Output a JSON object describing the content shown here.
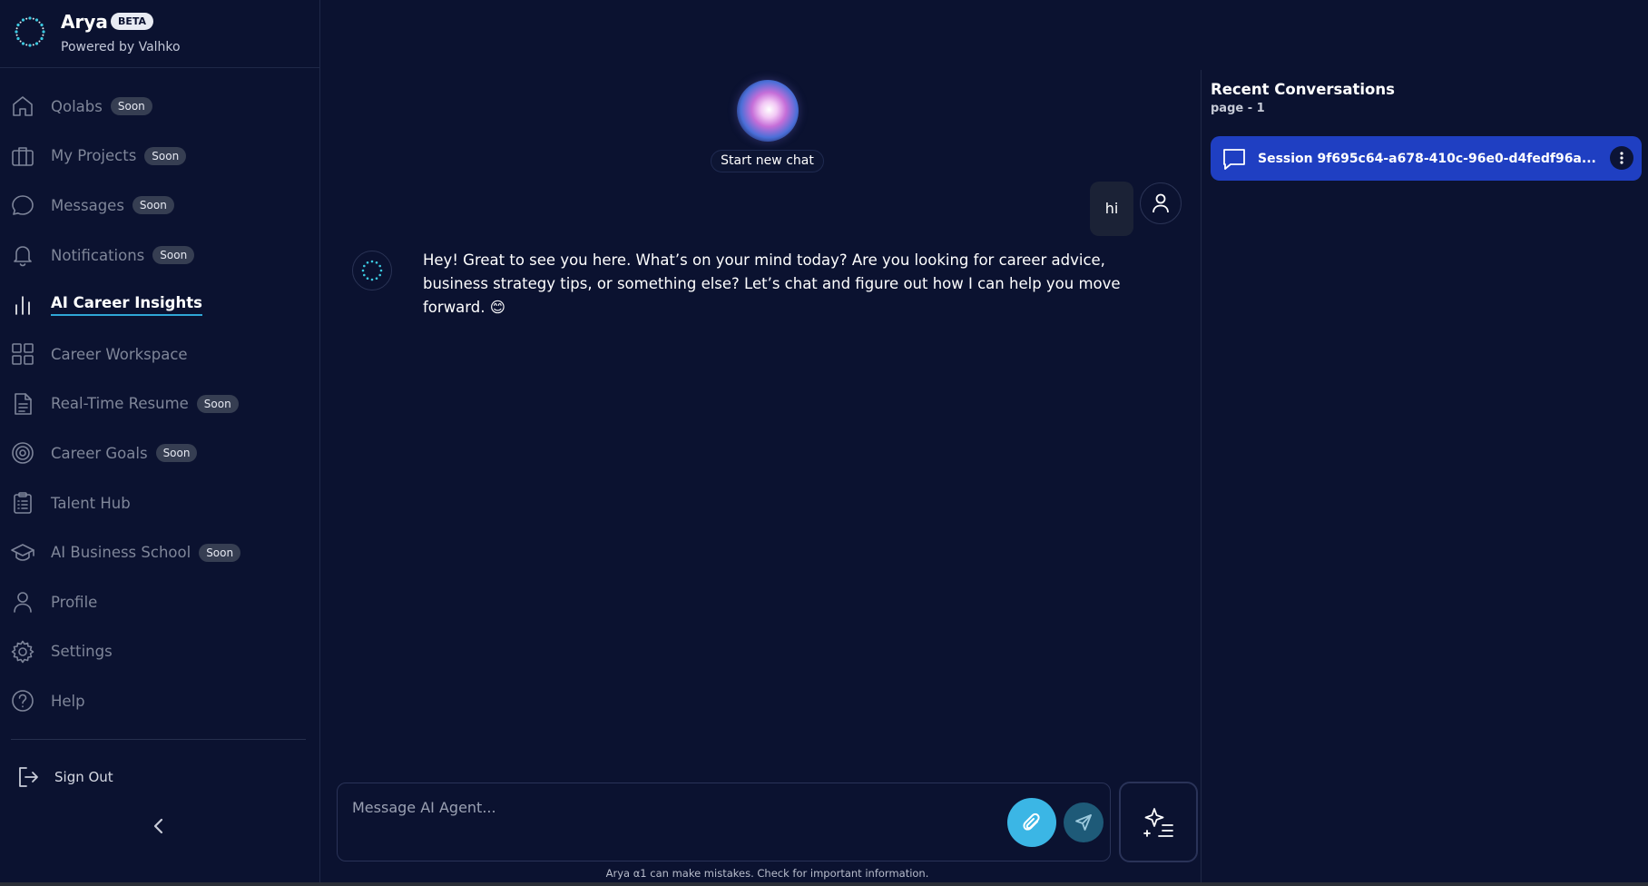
{
  "brand": {
    "name": "Arya",
    "badge": "BETA",
    "subtitle": "Powered by Valhko"
  },
  "sidebar": {
    "items": [
      {
        "label": "Qolabs",
        "badge": "Soon",
        "icon": "home-icon"
      },
      {
        "label": "My Projects",
        "badge": "Soon",
        "icon": "briefcase-icon"
      },
      {
        "label": "Messages",
        "badge": "Soon",
        "icon": "message-icon"
      },
      {
        "label": "Notifications",
        "badge": "Soon",
        "icon": "bell-icon"
      },
      {
        "label": "AI Career Insights",
        "badge": "",
        "icon": "bar-chart-icon",
        "active": true
      },
      {
        "label": "Career Workspace",
        "badge": "",
        "icon": "grid-icon"
      },
      {
        "label": "Real-Time Resume",
        "badge": "Soon",
        "icon": "document-icon"
      },
      {
        "label": "Career Goals",
        "badge": "Soon",
        "icon": "target-icon"
      },
      {
        "label": "Talent Hub",
        "badge": "",
        "icon": "clipboard-icon"
      },
      {
        "label": "AI Business School",
        "badge": "Soon",
        "icon": "graduation-cap-icon"
      },
      {
        "label": "Profile",
        "badge": "",
        "icon": "user-icon"
      },
      {
        "label": "Settings",
        "badge": "",
        "icon": "gear-icon"
      },
      {
        "label": "Help",
        "badge": "",
        "icon": "help-icon"
      }
    ],
    "sign_out": "Sign Out"
  },
  "chat": {
    "new_chat_label": "Start new chat",
    "messages": [
      {
        "role": "user",
        "text": "hi"
      },
      {
        "role": "assistant",
        "text": "Hey! Great to see you here. What’s on your mind today? Are you looking for career advice, business strategy tips, or something else? Let’s chat and figure out how I can help you move forward. 😊"
      }
    ],
    "input_placeholder": "Message AI Agent...",
    "disclaimer": "Arya α1 can make mistakes. Check for important information."
  },
  "recent": {
    "title": "Recent Conversations",
    "page_label": "page - 1",
    "sessions": [
      {
        "label": "Session 9f695c64-a678-410c-96e0-d4fedf96a..."
      }
    ]
  },
  "colors": {
    "background": "#0b1230",
    "accent": "#3bb6e5",
    "session_highlight": "#1f3fc2",
    "active_underline": "#2fa6d6"
  }
}
